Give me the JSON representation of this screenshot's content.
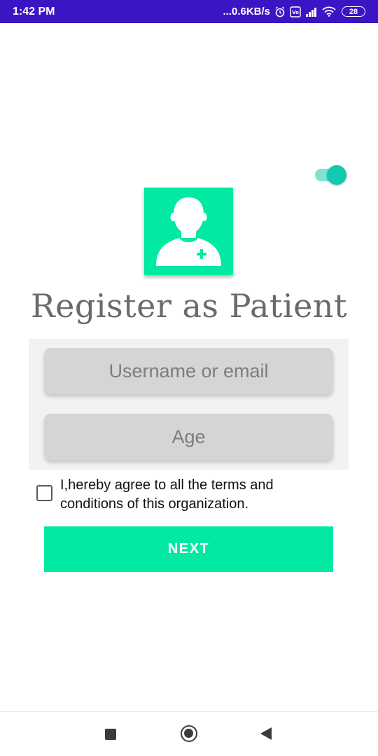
{
  "status_bar": {
    "time": "1:42 PM",
    "network_speed": "...0.6KB/s",
    "battery": "28",
    "background": "#3b14c4",
    "icons": [
      "alarm-icon",
      "volte-icon",
      "signal-icon",
      "wifi-icon",
      "battery-icon"
    ]
  },
  "toggle": {
    "on": true,
    "color": "#0fc9b0"
  },
  "logo": {
    "icon": "patient-avatar-icon",
    "background": "#01e9a3"
  },
  "title": "Register as Patient",
  "form": {
    "username_placeholder": "Username or email",
    "age_placeholder": "Age"
  },
  "terms": {
    "checked": false,
    "text": "I,hereby agree to all the terms and conditions of this organization."
  },
  "next_button": {
    "label": "NEXT",
    "color": "#01e9a3"
  },
  "nav_bar": {
    "icons": [
      "recent-apps-icon",
      "home-icon",
      "back-icon"
    ]
  }
}
